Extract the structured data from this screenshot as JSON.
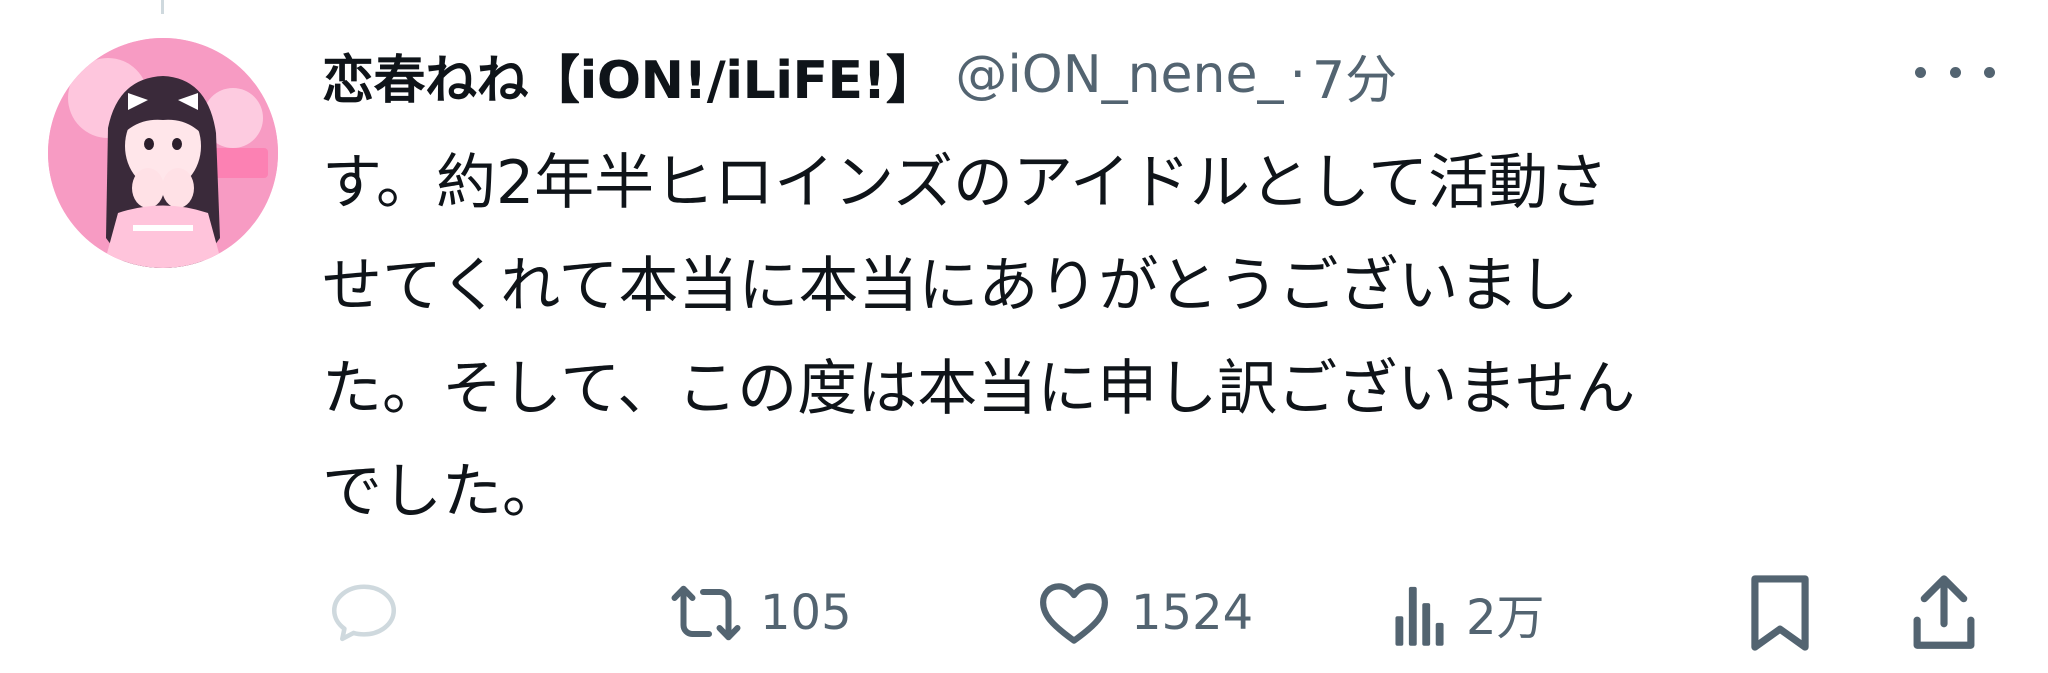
{
  "tweet": {
    "author": {
      "display_name": "恋春ねね【iON!/iLiFE!】",
      "handle": "@iON_nene_",
      "separator": "·",
      "time": "7分"
    },
    "body_lines": [
      "す。約2年半ヒロインズのアイドルとして活動さ",
      "せてくれて本当に本当にありがとうございまし",
      "た。そして、この度は本当に申し訳ございません",
      "でした。"
    ],
    "actions": {
      "reply": {
        "icon": "reply-icon",
        "count": ""
      },
      "retweet": {
        "icon": "retweet-icon",
        "count": "105"
      },
      "like": {
        "icon": "heart-icon",
        "count": "1524"
      },
      "views": {
        "icon": "views-icon",
        "count": "2万"
      },
      "bookmark": {
        "icon": "bookmark-icon"
      },
      "share": {
        "icon": "share-icon"
      }
    }
  },
  "colors": {
    "text_primary": "#0f1419",
    "text_secondary": "#536471",
    "thread_line": "#cfd9de",
    "reply_icon": "#cfd9de",
    "avatar_bg": "#f58ab6"
  }
}
